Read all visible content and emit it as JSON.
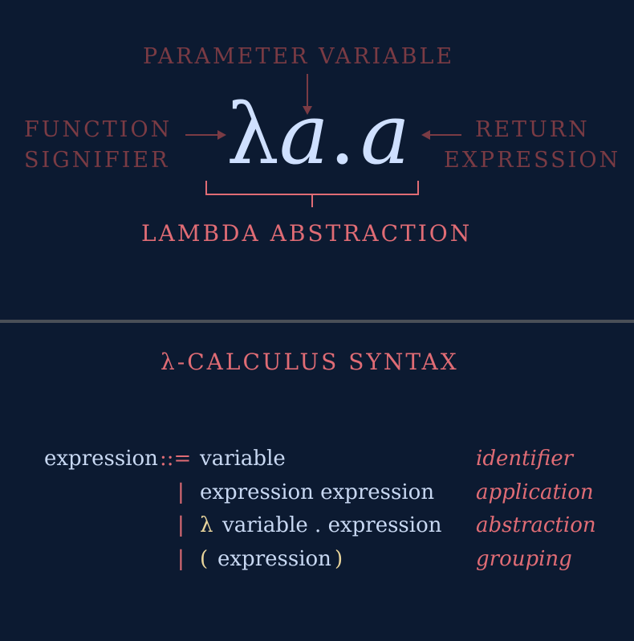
{
  "diagram": {
    "parameter_label": "PARAMETER VARIABLE",
    "function_label_line1": "FUNCTION",
    "function_label_line2": "SIGNIFIER",
    "return_label_line1": "RETURN",
    "return_label_line2": "EXPRESSION",
    "expression": {
      "lambda": "λ",
      "param": "a",
      "dot": ".",
      "body": "a"
    },
    "abstraction_label": "LAMBDA ABSTRACTION"
  },
  "syntax": {
    "title": "λ-CALCULUS SYNTAX",
    "lhs": "expression",
    "defines": "::=",
    "bar": "|",
    "rules": [
      {
        "rhs": "variable",
        "note": "identifier"
      },
      {
        "rhs": "expression expression",
        "note": "application"
      },
      {
        "rhs_lambda": "λ",
        "rhs": "variable . expression",
        "note": "abstraction"
      },
      {
        "rhs_open": "(",
        "rhs": "expression",
        "rhs_close": ")",
        "note": "grouping"
      }
    ]
  },
  "colors": {
    "background": "#0c1a31",
    "dim_label": "#7a3b44",
    "accent": "#e06c75",
    "expression": "#cfe0ff",
    "punctuation": "#e8d49b",
    "divider": "#4a4f57"
  }
}
